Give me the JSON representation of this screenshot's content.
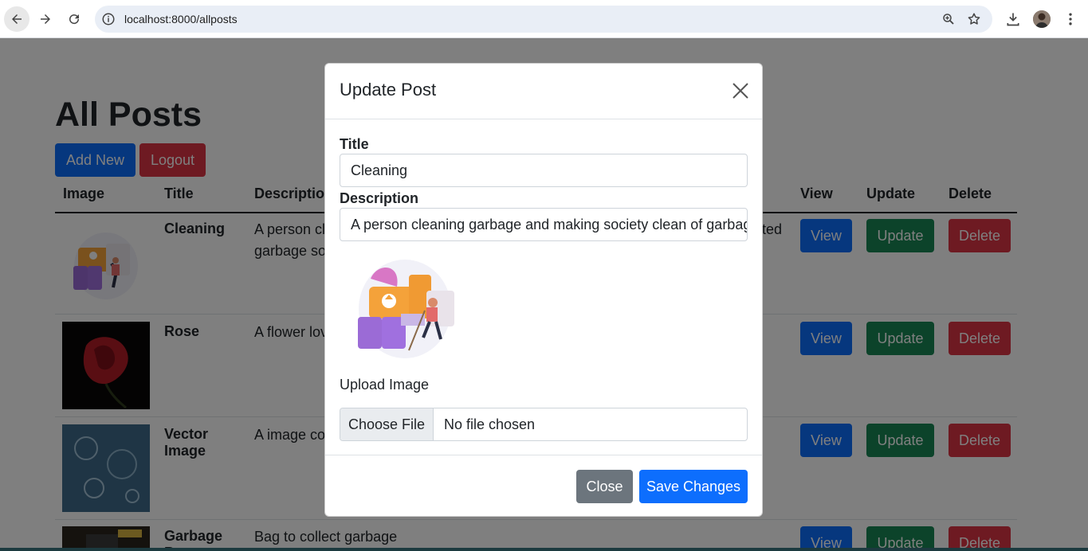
{
  "browser": {
    "url": "localhost:8000/allposts"
  },
  "page": {
    "title": "All Posts",
    "add_new_label": "Add New",
    "logout_label": "Logout",
    "columns": [
      "Image",
      "Title",
      "Description",
      "View",
      "Update",
      "Delete"
    ],
    "rows": [
      {
        "title": "Cleaning",
        "description": "A person cleaning garbage and making society clean of garbage so that people are not affected by it. Society awareness related garbage something",
        "view_label": "View",
        "update_label": "Update",
        "delete_label": "Delete"
      },
      {
        "title": "Rose",
        "description": "A flower lover",
        "view_label": "View",
        "update_label": "Update",
        "delete_label": "Delete"
      },
      {
        "title": "Vector Image",
        "description": "A image co",
        "view_label": "View",
        "update_label": "Update",
        "delete_label": "Delete"
      },
      {
        "title": "Garbage Bag",
        "description": "Bag to collect garbage",
        "view_label": "View",
        "update_label": "Update",
        "delete_label": "Delete"
      }
    ],
    "row1_desc_line1": "A person cle",
    "row1_desc_line2": "garbage so",
    "row1_desc_tail": "ted"
  },
  "modal": {
    "title": "Update Post",
    "title_label": "Title",
    "title_value": "Cleaning",
    "description_label": "Description",
    "description_value": "A person cleaning garbage and making society clean of garbage",
    "upload_label": "Upload Image",
    "choose_file_label": "Choose File",
    "no_file_text": "No file chosen",
    "close_label": "Close",
    "save_label": "Save Changes"
  },
  "colors": {
    "primary": "#0d6efd",
    "danger": "#dc3545",
    "success": "#198754",
    "secondary": "#6c757d"
  }
}
